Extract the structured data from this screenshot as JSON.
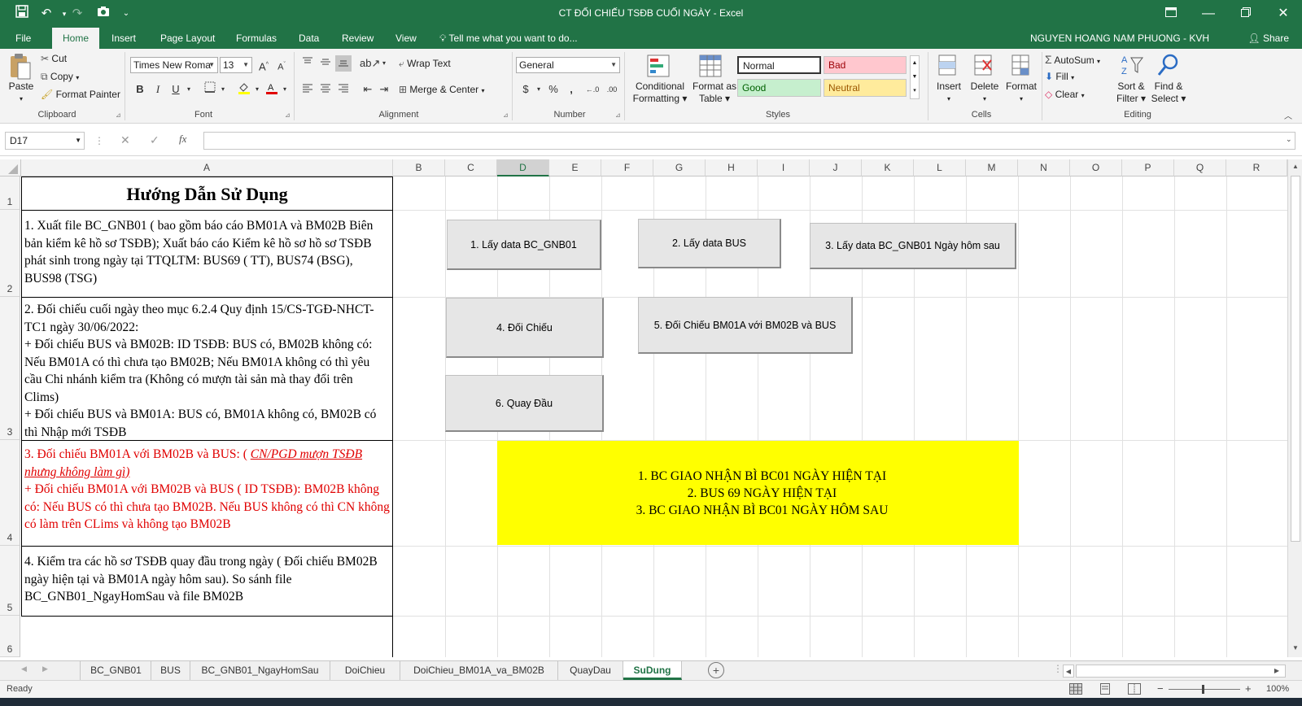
{
  "window": {
    "title": "CT ĐỐI CHIẾU TSĐB CUỐI NGÀY - Excel",
    "user": "NGUYEN HOANG NAM PHUONG - KVH",
    "share": "Share"
  },
  "tabs": [
    "File",
    "Home",
    "Insert",
    "Page Layout",
    "Formulas",
    "Data",
    "Review",
    "View"
  ],
  "tell_me": "Tell me what you want to do...",
  "ribbon": {
    "clipboard": {
      "paste": "Paste",
      "cut": "Cut",
      "copy": "Copy",
      "format_painter": "Format Painter",
      "label": "Clipboard"
    },
    "font": {
      "name": "Times New Roma",
      "size": "13",
      "label": "Font"
    },
    "alignment": {
      "wrap_text": "Wrap Text",
      "merge_center": "Merge & Center",
      "label": "Alignment"
    },
    "number": {
      "format": "General",
      "label": "Number"
    },
    "styles": {
      "conditional_formatting": "Conditional Formatting",
      "format_as_table": "Format as Table",
      "normal": "Normal",
      "bad": "Bad",
      "good": "Good",
      "neutral": "Neutral",
      "label": "Styles"
    },
    "cells": {
      "insert": "Insert",
      "delete": "Delete",
      "format": "Format",
      "label": "Cells"
    },
    "editing": {
      "autosum": "AutoSum",
      "fill": "Fill",
      "clear": "Clear",
      "sort_filter": "Sort & Filter",
      "find_select": "Find & Select",
      "label": "Editing"
    }
  },
  "formula_bar": {
    "name_box": "D17",
    "fx": "fx",
    "value": ""
  },
  "columns": [
    "A",
    "B",
    "C",
    "D",
    "E",
    "F",
    "G",
    "H",
    "I",
    "J",
    "K",
    "L",
    "M",
    "N",
    "O",
    "P",
    "Q",
    "R"
  ],
  "rows": [
    "1",
    "2",
    "3",
    "4",
    "5",
    "6"
  ],
  "cells": {
    "a1": "Hướng Dẫn Sử Dụng",
    "a2": "1. Xuất file BC_GNB01 ( bao gồm báo cáo BM01A và BM02B Biên bản kiểm kê hồ sơ TSĐB); Xuất báo cáo Kiểm kê hồ sơ hồ sơ TSĐB phát sinh trong ngày tại TTQLTM:  BUS69 ( TT), BUS74 (BSG), BUS98 (TSG)",
    "a3": {
      "line1": "2. Đối chiếu cuối ngày theo mục 6.2.4 Quy định 15/CS-TGĐ-NHCT-TC1 ngày 30/06/2022:",
      "line2": "+  Đối chiếu BUS và BM02B: ID TSĐB: BUS có, BM02B không có: Nếu BM01A có thì chưa tạo BM02B; Nếu BM01A không có thì yêu cầu Chi nhánh kiểm tra (Không có mượn tài sản mà thay đổi trên Clims)",
      "line3": "+ Đối chiếu BUS và BM01A: BUS có, BM01A không có, BM02B có thì Nhập mới TSĐB"
    },
    "a4": {
      "line1_prefix": "3. Đối chiếu BM01A với BM02B và BUS: ( ",
      "line1_italic": "CN/PGD mượn TSĐB nhưng không làm gì)",
      "line2": "+ Đối chiếu BM01A với BM02B và BUS ( ID TSĐB):  BM02B không có: Nếu  BUS có thì chưa tạo BM02B. Nếu BUS không có thì CN không có làm trên CLims và không tạo BM02B"
    },
    "a5": "4. Kiểm tra các hồ sơ TSĐB quay đầu trong ngày ( Đối chiếu BM02B ngày hiện tại và BM01A ngày hôm sau). So sánh file BC_GNB01_NgayHomSau và file BM02B"
  },
  "macro_buttons": [
    "1. Lấy data BC_GNB01",
    "2. Lấy data BUS",
    "3. Lấy data BC_GNB01 Ngày hôm sau",
    "4. Đối Chiếu",
    "5. Đối Chiếu BM01A với BM02B và BUS",
    "6. Quay Đầu"
  ],
  "yellow_box": [
    "1. BC GIAO NHẬN BÌ BC01 NGÀY HIỆN TẠI",
    "2. BUS 69 NGÀY HIỆN TẠI",
    "3. BC GIAO NHẬN BÌ BC01 NGÀY HÔM SAU"
  ],
  "sheets": [
    "BC_GNB01",
    "BUS",
    "BC_GNB01_NgayHomSau",
    "DoiChieu",
    "DoiChieu_BM01A_va_BM02B",
    "QuayDau",
    "SuDung"
  ],
  "active_sheet": "SuDung",
  "status": {
    "ready": "Ready",
    "zoom": "100%"
  },
  "colors": {
    "excel_green": "#217346",
    "yellow": "#ffff00",
    "red_text": "#e00000"
  }
}
